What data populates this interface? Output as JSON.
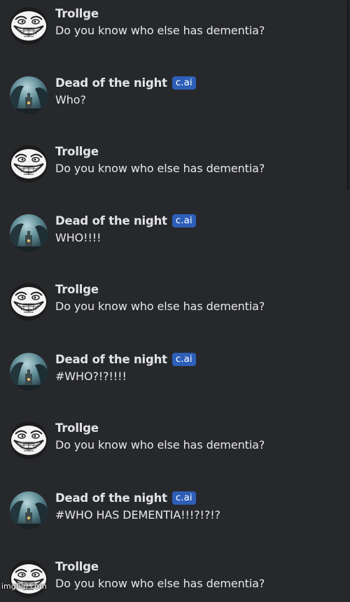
{
  "messages": [
    {
      "author": "Trollge",
      "avatar_icon": "troll-face-icon",
      "bot": false,
      "text": "Do you know who else has dementia?"
    },
    {
      "author": "Dead of the night",
      "avatar_icon": "night-scene-avatar-icon",
      "bot": true,
      "badge": "c.ai",
      "text": "Who?"
    },
    {
      "author": "Trollge",
      "avatar_icon": "troll-face-icon",
      "bot": false,
      "text": "Do you know who else has dementia?"
    },
    {
      "author": "Dead of the night",
      "avatar_icon": "night-scene-avatar-icon",
      "bot": true,
      "badge": "c.ai",
      "text": "WHO!!!!"
    },
    {
      "author": "Trollge",
      "avatar_icon": "troll-face-icon",
      "bot": false,
      "text": "Do you know who else has dementia?"
    },
    {
      "author": "Dead of the night",
      "avatar_icon": "night-scene-avatar-icon",
      "bot": true,
      "badge": "c.ai",
      "text": "#WHO?!?!!!!"
    },
    {
      "author": "Trollge",
      "avatar_icon": "troll-face-icon",
      "bot": false,
      "text": "Do you know who else has dementia?"
    },
    {
      "author": "Dead of the night",
      "avatar_icon": "night-scene-avatar-icon",
      "bot": true,
      "badge": "c.ai",
      "text": "#WHO HAS DEMENTIA!!!?!?!?"
    },
    {
      "author": "Trollge",
      "avatar_icon": "troll-face-icon",
      "bot": false,
      "text": "Do you know who else has dementia?"
    }
  ],
  "watermark": "imgflip.com",
  "colors": {
    "background": "#27282c",
    "badge": "#2d5fb8",
    "name_text": "#e3e4e8",
    "message_text": "#e8e9ec"
  }
}
